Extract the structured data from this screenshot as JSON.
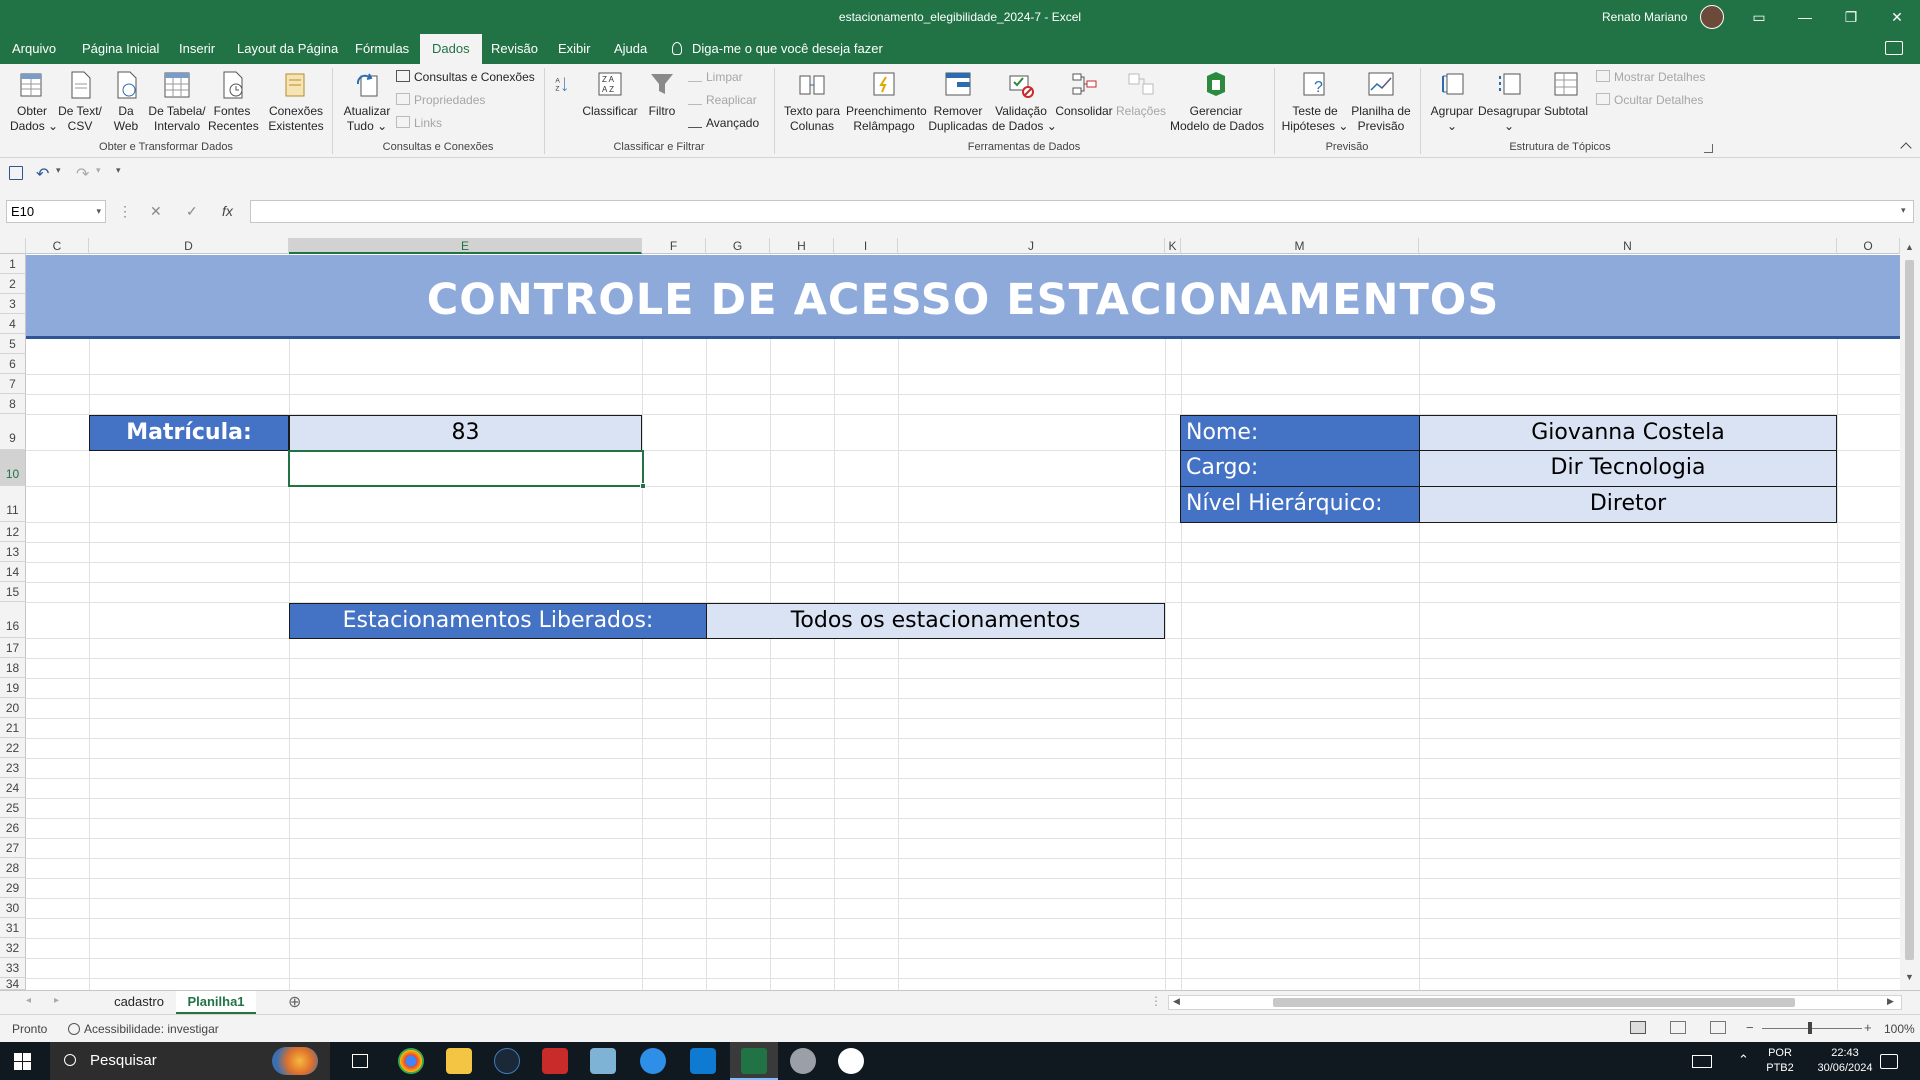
{
  "window": {
    "title": "estacionamento_elegibilidade_2024-7  -  Excel",
    "user": "Renato Mariano",
    "controls": {
      "ribbon_display": "▭",
      "minimize": "—",
      "maximize": "❐",
      "close": "✕"
    }
  },
  "menu": {
    "tabs": [
      "Arquivo",
      "Página Inicial",
      "Inserir",
      "Layout da Página",
      "Fórmulas",
      "Dados",
      "Revisão",
      "Exibir",
      "Ajuda"
    ],
    "active_tab": "Dados",
    "tell_me": "Diga-me o que você deseja fazer"
  },
  "ribbon": {
    "groups": [
      {
        "label": "Obter e Transformar Dados"
      },
      {
        "label": "Consultas e Conexões"
      },
      {
        "label": "Classificar e Filtrar"
      },
      {
        "label": "Ferramentas de Dados"
      },
      {
        "label": "Previsão"
      },
      {
        "label": "Estrutura de Tópicos"
      }
    ],
    "buttons": {
      "obter_dados": "Obter\nDados ⌄",
      "de_text_csv": "De Text/\nCSV",
      "da_web": "Da\nWeb",
      "de_tabela": "De Tabela/\nIntervalo",
      "fontes_recentes": "Fontes\nRecentes",
      "conexoes_existentes": "Conexões\nExistentes",
      "atualizar_tudo": "Atualizar\nTudo ⌄",
      "consultas_conexoes": "Consultas e Conexões",
      "propriedades": "Propriedades",
      "links": "Links",
      "classificar": "Classificar",
      "filtro": "Filtro",
      "limpar": "Limpar",
      "reaplicar": "Reaplicar",
      "avancado": "Avançado",
      "texto_colunas": "Texto para\nColunas",
      "preenchimento": "Preenchimento\nRelâmpago",
      "remover_duplicadas": "Remover\nDuplicadas",
      "validacao": "Validação\nde Dados ⌄",
      "consolidar": "Consolidar",
      "relacoes": "Relações",
      "gerenciar_modelo": "Gerenciar\nModelo de Dados",
      "teste_hipoteses": "Teste de\nHipóteses ⌄",
      "planilha_previsao": "Planilha de\nPrevisão",
      "agrupar": "Agrupar\n⌄",
      "desagrupar": "Desagrupar\n⌄",
      "subtotal": "Subtotal",
      "mostrar_detalhes": "Mostrar Detalhes",
      "ocultar_detalhes": "Ocultar Detalhes"
    }
  },
  "formula_bar": {
    "name_box": "E10",
    "formula": "",
    "icons": {
      "cancel": "✕",
      "enter": "✓",
      "fx": "fx"
    }
  },
  "sheet": {
    "columns": [
      "C",
      "D",
      "E",
      "F",
      "G",
      "H",
      "I",
      "J",
      "K",
      "M",
      "N",
      "O"
    ],
    "selected_column": "E",
    "rows": [
      "1",
      "2",
      "3",
      "4",
      "5",
      "6",
      "7",
      "8",
      "9",
      "10",
      "11",
      "12",
      "13",
      "14",
      "15",
      "16",
      "17",
      "18",
      "19",
      "20",
      "21",
      "22",
      "23",
      "24",
      "25",
      "26",
      "27",
      "28",
      "29",
      "30",
      "31",
      "32",
      "33",
      "34"
    ],
    "selected_row": "10",
    "banner_title": "CONTROLE DE ACESSO ESTACIONAMENTOS",
    "matricula_label": "Matrícula:",
    "matricula_value": "83",
    "nome_label": "Nome:",
    "nome_value": "Giovanna Costela",
    "cargo_label": "Cargo:",
    "cargo_value": "Dir Tecnologia",
    "nivel_label": "Nível Hierárquico:",
    "nivel_value": "Diretor",
    "liberados_label": "Estacionamentos Liberados:",
    "liberados_value": "Todos os estacionamentos"
  },
  "sheet_tabs": {
    "tabs": [
      "cadastro",
      "Planilha1"
    ],
    "active": "Planilha1",
    "add": "⊕"
  },
  "status": {
    "ready": "Pronto",
    "accessibility": "Acessibilidade: investigar",
    "zoom": "100%"
  },
  "taskbar": {
    "search_placeholder": "Pesquisar",
    "lang": "POR\nPTB2",
    "time": "22:43",
    "date": "30/06/2024"
  }
}
